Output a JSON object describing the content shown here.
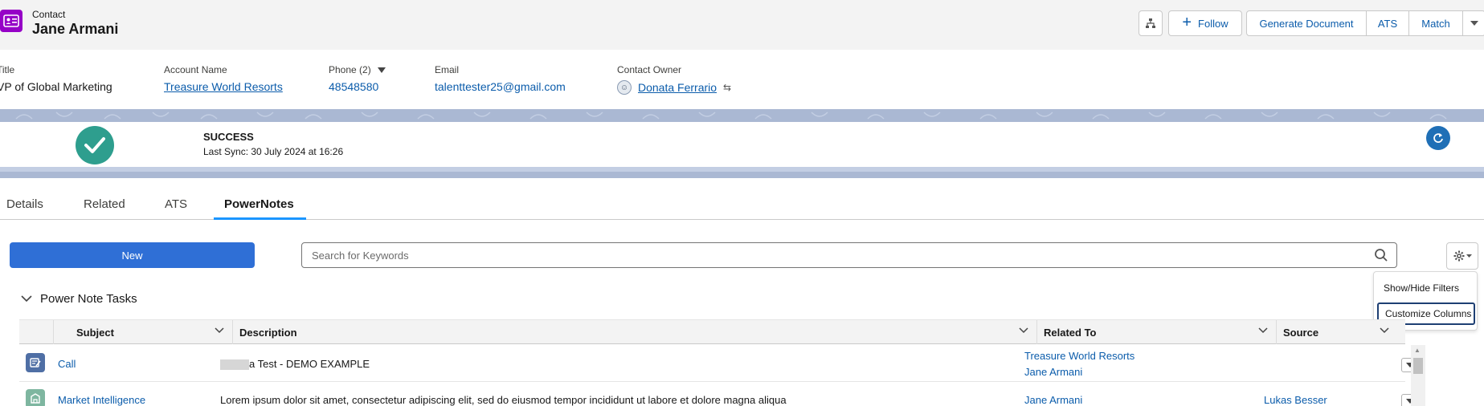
{
  "header": {
    "object_type": "Contact",
    "record_name": "Jane Armani",
    "follow_label": "Follow",
    "buttons": [
      "Generate Document",
      "ATS",
      "Match"
    ]
  },
  "highlights": {
    "title_label": "Title",
    "title_value": "VP of Global Marketing",
    "account_label": "Account Name",
    "account_value": "Treasure World Resorts",
    "phone_label": "Phone (2)",
    "phone_value": "48548580",
    "email_label": "Email",
    "email_value": "talenttester25@gmail.com",
    "owner_label": "Contact Owner",
    "owner_value": "Donata Ferrario"
  },
  "sync": {
    "status": "SUCCESS",
    "last_sync": "Last Sync:  30 July 2024 at 16:26"
  },
  "tabs": [
    {
      "label": "Details",
      "active": false
    },
    {
      "label": "Related",
      "active": false
    },
    {
      "label": "ATS",
      "active": false
    },
    {
      "label": "PowerNotes",
      "active": true
    }
  ],
  "toolbar": {
    "new_label": "New",
    "search_placeholder": "Search for Keywords"
  },
  "settings_menu": {
    "items": [
      "Show/Hide Filters",
      "Customize Columns"
    ]
  },
  "section": {
    "title": "Power Note Tasks"
  },
  "table": {
    "columns": [
      "Subject",
      "Description",
      "Related To",
      "Source"
    ],
    "rows": [
      {
        "subject": "Call",
        "description": "a Test - DEMO EXAMPLE",
        "related_to": [
          "Treasure World Resorts",
          "Jane Armani"
        ],
        "source": ""
      },
      {
        "subject": "Market Intelligence",
        "description": "Lorem ipsum dolor sit amet, consectetur adipiscing elit, sed do eiusmod tempor incididunt ut labore et dolore magna aliqua",
        "related_to": [
          "Jane Armani"
        ],
        "source": "Lukas Besser"
      }
    ]
  },
  "colors": {
    "brand_blue": "#0b5cab",
    "button_blue": "#2f6fd6",
    "success_green": "#2e9e8e",
    "contact_purple": "#9602c7"
  }
}
